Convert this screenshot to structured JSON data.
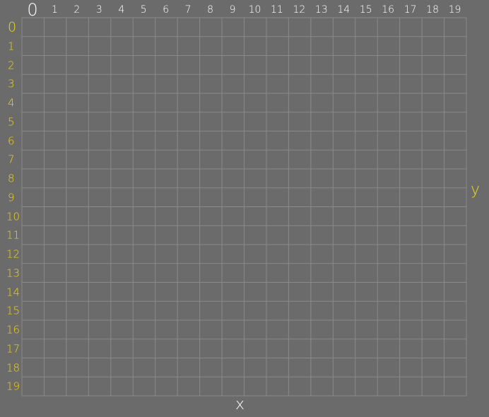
{
  "columns": [
    "0",
    "1",
    "2",
    "3",
    "4",
    "5",
    "6",
    "7",
    "8",
    "9",
    "10",
    "11",
    "12",
    "13",
    "14",
    "15",
    "16",
    "17",
    "18",
    "19"
  ],
  "rows": [
    "0",
    "1",
    "2",
    "3",
    "4",
    "5",
    "6",
    "7",
    "8",
    "9",
    "10",
    "11",
    "12",
    "13",
    "14",
    "15",
    "16",
    "17",
    "18",
    "19"
  ],
  "axes": {
    "x_label": "x",
    "y_label": "y"
  },
  "colors": {
    "background": "#6b6b6b",
    "grid_line": "#8a8a8a",
    "column_text": "#ffffff",
    "row_text": "#f5d90a"
  }
}
